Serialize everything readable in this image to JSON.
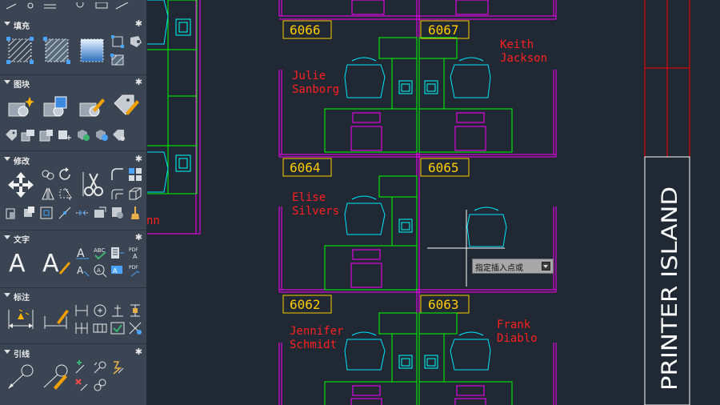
{
  "palette": {
    "sections": [
      {
        "id": "hatch",
        "title": "填充"
      },
      {
        "id": "block",
        "title": "图块"
      },
      {
        "id": "modify",
        "title": "修改"
      },
      {
        "id": "text",
        "title": "文字"
      },
      {
        "id": "dimension",
        "title": "标注"
      },
      {
        "id": "leader",
        "title": "引线"
      }
    ],
    "gear_icon": "gear-icon"
  },
  "drawing": {
    "colors": {
      "background": "#1f2833",
      "partition": "#ff00ff",
      "desk": "#00ff00",
      "chair": "#00e5ff",
      "label_box": "#ffcc00",
      "name": "#ff2020",
      "printer_frame": "#ffffff",
      "printer_lines": "#ff0000"
    },
    "desk_numbers": {
      "d6066": "6066",
      "d6067": "6067",
      "d6064": "6064",
      "d6065": "6065",
      "d6062": "6062",
      "d6063": "6063"
    },
    "names": {
      "keith_1": "Keith",
      "keith_2": "Jackson",
      "julie_1": "Julie",
      "julie_2": "Sanborg",
      "elise_1": "Elise",
      "elise_2": "Silvers",
      "jennifer_1": "Jennifer",
      "jennifer_2": "Schmidt",
      "frank_1": "Frank",
      "frank_2": "Diablo",
      "partial": "nn"
    },
    "printer_label": "PRINTER ISLAND",
    "command_prompt": "指定插入点或"
  }
}
